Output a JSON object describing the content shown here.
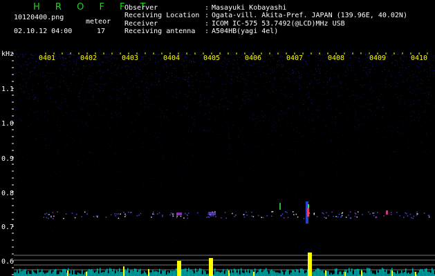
{
  "header": {
    "brand": "H R O F F T",
    "filename": "10120400.png",
    "meteor_label": "meteor",
    "datetime": "02.10.12 04:00",
    "meteor_count": "17"
  },
  "info": [
    {
      "key": "Observer",
      "sep": ":",
      "value": "Masayuki Kobayashi"
    },
    {
      "key": "Receiving Location",
      "sep": ":",
      "value": "Ogata-vill. Akita-Pref. JAPAN (139.96E, 40.02N)"
    },
    {
      "key": "Receiver",
      "sep": ":",
      "value": "ICOM IC-575 53.7492(@LCD)MHz USB"
    },
    {
      "key": "Receiving antenna",
      "sep": ":",
      "value": "A504HB(yagi 4el)"
    }
  ],
  "x_ticks": [
    "0401",
    "0402",
    "0403",
    "0404",
    "0405",
    "0406",
    "0407",
    "0408",
    "0409",
    "0410"
  ],
  "y_axis": {
    "unit": "kHz",
    "labels": [
      "1.1",
      "1.0",
      "0.9",
      "0.8",
      "0.7",
      "0.6"
    ]
  },
  "colors": {
    "brand": "#19d919",
    "tick": "#ffff00",
    "noise": "#2a1fa0",
    "signal_yellow": "#ffff00",
    "signal_cyan": "#00d0d0",
    "carrier_line": "#a0a0a0"
  }
}
